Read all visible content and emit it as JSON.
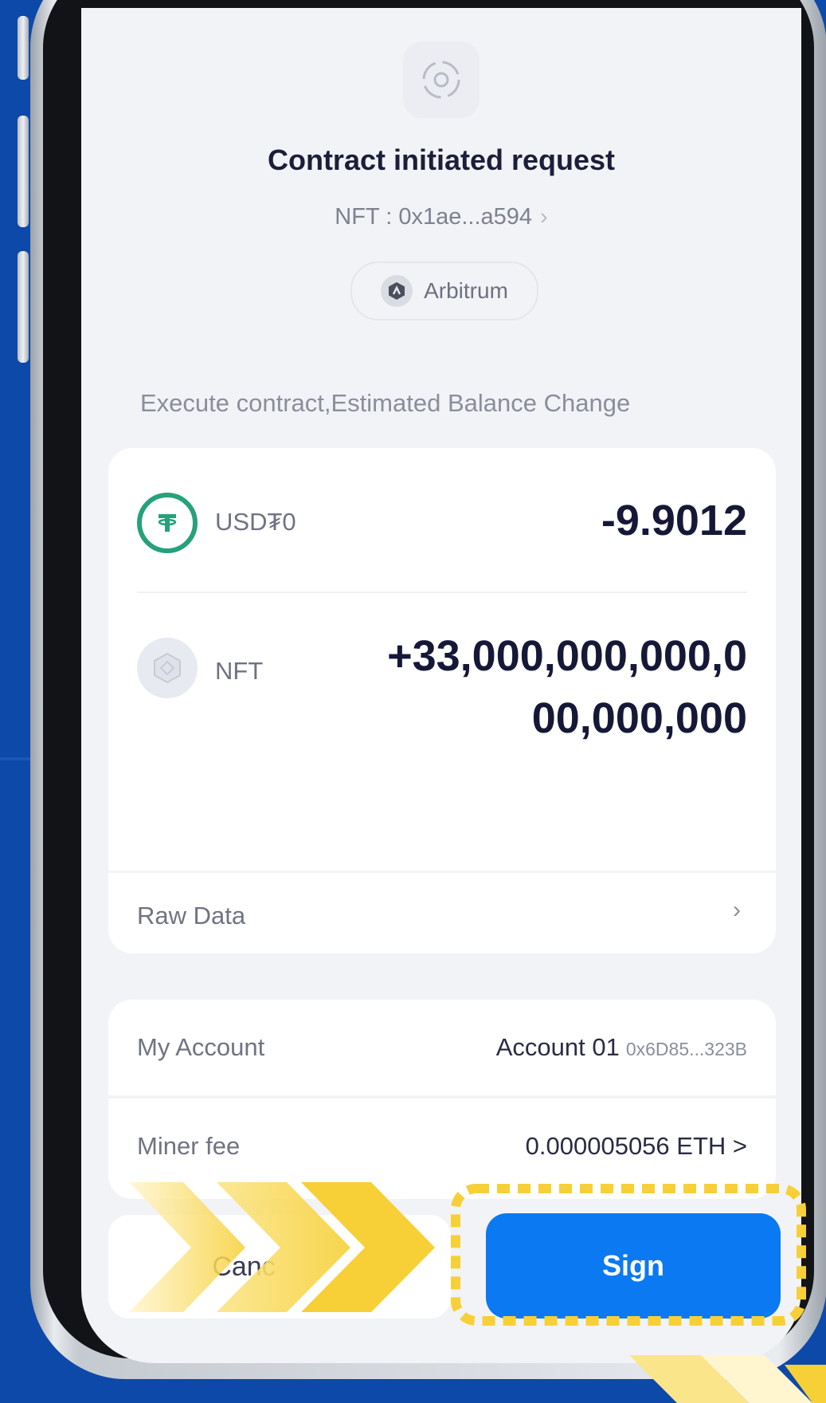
{
  "header": {
    "title": "Contract initiated request",
    "contract_label": "NFT : 0x1ae...a594",
    "network": "Arbitrum"
  },
  "balance_section": {
    "label": "Execute contract,Estimated Balance Change",
    "items": [
      {
        "asset": "USD₮0",
        "amount": "-9.9012",
        "icon": "usdt0-token-icon",
        "icon_color": "#26a17b"
      },
      {
        "asset": "NFT",
        "amount": "+33,000,000,000,000,000,000",
        "icon": "nft-token-icon"
      }
    ],
    "raw_data_label": "Raw Data"
  },
  "account": {
    "my_account_label": "My Account",
    "account_name": "Account 01",
    "account_address": "0x6D85...323B",
    "miner_fee_label": "Miner fee",
    "miner_fee_value": "0.000005056 ETH >"
  },
  "buttons": {
    "cancel_label": "Canc",
    "sign_label": "Sign"
  },
  "colors": {
    "background": "#0d49a8",
    "sign_button": "#0b79f2",
    "highlight": "#f7d038"
  }
}
